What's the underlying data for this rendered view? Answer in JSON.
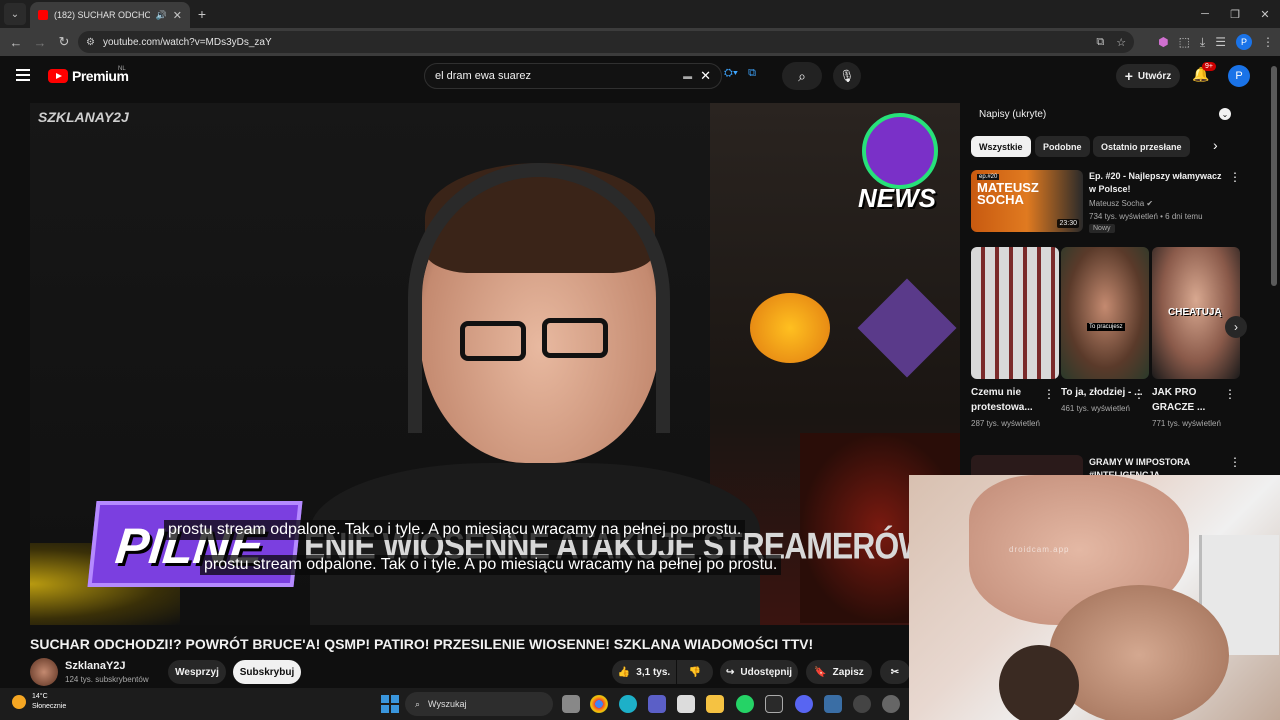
{
  "browser": {
    "tab_title": "(182) SUCHAR ODCHODZI!",
    "url": "youtube.com/watch?v=MDs3yDs_zaY",
    "profile_initial": "P"
  },
  "yt": {
    "logo_text": "Premium",
    "country": "NL",
    "search_value": "el dram ewa suarez",
    "create_label": "Utwórz",
    "notif_count": "9+",
    "avatar_initial": "P"
  },
  "video": {
    "watermark": "SZKLANAY2J",
    "news_text": "NEWS",
    "pilne_text": "PILNE",
    "ticker_text": "ENIE WIOSENNE ATAKUJE STREAMERÓW!?",
    "subtitle_1": "prostu stream odpalone. Tak o i tyle. A po miesiącu wracamy na pełnej po prostu.",
    "subtitle_2": "prostu stream odpalone. Tak o i tyle. A po miesiącu wracamy na pełnej po prostu.",
    "title": "SUCHAR ODCHODZI!? POWRÓT BRUCE'A! QSMP! PATIRO! PRZESILENIE WIOSENNE! SZKLANA WIADOMOŚCI TTV!"
  },
  "owner": {
    "channel_name": "SzklanaY2J",
    "subscribers": "124 tys. subskrybentów",
    "support_label": "Wesprzyj",
    "subscribe_label": "Subskrybuj",
    "likes": "3,1 tys.",
    "share_label": "Udostępnij",
    "save_label": "Zapisz"
  },
  "sidebar": {
    "captions": "Napisy (ukryte)",
    "chips": [
      "Wszystkie",
      "Podobne",
      "Ostatnio przesłane"
    ],
    "rec1": {
      "thumb_tag": "ep.#20",
      "thumb_name": "MATEUSZ SOCHA",
      "duration": "23:30",
      "title": "Ep. #20 - Najlepszy włamywacz w Polsce!",
      "channel": "Mateusz Socha",
      "stats": "734 tys. wyświetleń • 6 dni temu",
      "badge": "Nowy"
    },
    "shorts": [
      {
        "title": "Czemu nie protestowa...",
        "views": "287 tys. wyświetleń",
        "overlay": ""
      },
      {
        "title": "To ja, złodziej - ...",
        "views": "461 tys. wyświetleń",
        "overlay": "To pracujesz"
      },
      {
        "title": "JAK PRO GRACZE ...",
        "views": "771 tys. wyświetleń",
        "overlay": "CHEATUJĄ"
      }
    ],
    "rec3": {
      "title": "GRAMY W IMPOSTORA",
      "title_2": "#INTELIGENCJA"
    }
  },
  "webcam": {
    "watermark": "droidcam.app"
  },
  "taskbar": {
    "temp": "14°C",
    "weather": "Słonecznie",
    "search_placeholder": "Wyszukaj"
  },
  "colors": {
    "accent_red": "#ff0000",
    "brand_purple": "#7b3fe0",
    "link_blue": "#3ea6ff"
  }
}
